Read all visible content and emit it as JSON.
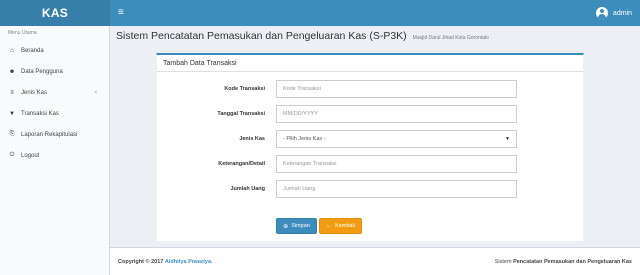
{
  "header": {
    "logo": "KAS",
    "menu_icon": "≡",
    "username": "admin"
  },
  "sidebar": {
    "header": "Menu Utama",
    "items": [
      {
        "label": "Beranda",
        "icon": "⌂"
      },
      {
        "label": "Data Pengguna",
        "icon": "☻"
      },
      {
        "label": "Jenis Kas",
        "icon": "≡"
      },
      {
        "label": "Transaksi Kas",
        "icon": "▼"
      },
      {
        "label": "Laporan Rekapitulasi",
        "icon": "⎘"
      },
      {
        "label": "Logout",
        "icon": "⏻"
      }
    ],
    "chevron": "‹"
  },
  "page": {
    "title": "Sistem Pencatatan Pemasukan dan Pengeluaran Kas (S-P3K)",
    "subtitle": "Masjid Darul Jihad Kota Gorontalo"
  },
  "form": {
    "title": "Tambah Data Transaksi",
    "fields": [
      {
        "label": "Kode Transaksi",
        "placeholder": "Kode Transaksi"
      },
      {
        "label": "Tanggal Transaksi",
        "placeholder": "MM/DD/YYYY"
      },
      {
        "label": "Jenis Kas",
        "selected": "- Pilih Jenis Kas -"
      },
      {
        "label": "Keterangan/Detail",
        "placeholder": "Keterangan Transaksi"
      },
      {
        "label": "Jumlah Uang",
        "placeholder": "Jumlah Uang"
      }
    ],
    "save_label": "Simpan",
    "back_label": "Kembali",
    "save_icon": "⊗",
    "back_icon": "←"
  },
  "footer": {
    "copyright": "Copyright © 2017",
    "author": "Aldhitya Prasetya.",
    "right_prefix": "Sistem",
    "right_bold": "Pencatatan Pemasukan dan Pengeluaran Kas"
  },
  "colors": {
    "primary": "#3c8dbc",
    "logo_bg": "#367fa9",
    "warning": "#f39c12",
    "background": "#ecf0f5"
  }
}
